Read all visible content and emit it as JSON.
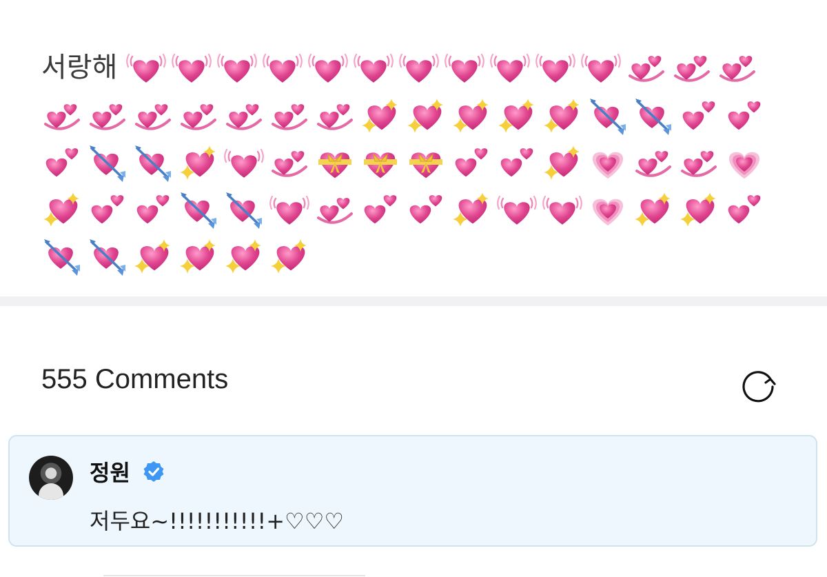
{
  "post": {
    "text": "서랑해",
    "emojis": [
      "vibrating-heart",
      "vibrating-heart",
      "vibrating-heart",
      "vibrating-heart",
      "vibrating-heart",
      "vibrating-heart",
      "vibrating-heart",
      "vibrating-heart",
      "vibrating-heart",
      "vibrating-heart",
      "vibrating-heart",
      "revolving-hearts",
      "revolving-hearts",
      "revolving-hearts",
      "revolving-hearts",
      "revolving-hearts",
      "revolving-hearts",
      "revolving-hearts",
      "revolving-hearts",
      "revolving-hearts",
      "revolving-hearts",
      "sparkling-heart",
      "sparkling-heart",
      "sparkling-heart",
      "sparkling-heart",
      "sparkling-heart",
      "arrow-heart",
      "arrow-heart",
      "two-hearts",
      "two-hearts",
      "two-hearts",
      "arrow-heart",
      "arrow-heart",
      "sparkling-heart",
      "vibrating-heart",
      "revolving-hearts",
      "ribbon-heart",
      "ribbon-heart",
      "ribbon-heart",
      "two-hearts",
      "two-hearts",
      "sparkling-heart",
      "growing-heart",
      "revolving-hearts",
      "revolving-hearts",
      "growing-heart",
      "sparkling-heart",
      "two-hearts",
      "two-hearts",
      "arrow-heart",
      "arrow-heart",
      "vibrating-heart",
      "revolving-hearts",
      "two-hearts",
      "two-hearts",
      "sparkling-heart",
      "vibrating-heart",
      "vibrating-heart",
      "growing-heart",
      "sparkling-heart",
      "sparkling-heart",
      "two-hearts",
      "arrow-heart",
      "arrow-heart",
      "sparkling-heart",
      "sparkling-heart",
      "sparkling-heart",
      "sparkling-heart"
    ]
  },
  "comments": {
    "header": "555 Comments",
    "refresh_icon": "refresh-icon",
    "items": [
      {
        "author": "정원",
        "verified": true,
        "text": "저두요~!!!!!!!!!!!+♡♡♡"
      }
    ]
  },
  "colors": {
    "heart_pink": "#e0458f",
    "card_bg": "#eef7fd",
    "card_border": "#cfe2ee",
    "verified_blue": "#3d97f5"
  }
}
